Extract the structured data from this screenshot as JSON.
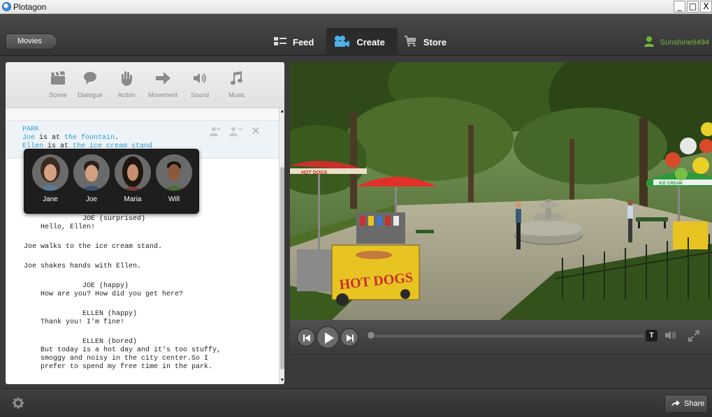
{
  "window": {
    "title": "Plotagon",
    "minimize": "_",
    "maximize": "□",
    "close": "X"
  },
  "nav": {
    "movies_label": "Movies",
    "tabs": [
      {
        "label": "Feed",
        "icon": "feed-icon"
      },
      {
        "label": "Create",
        "icon": "camera-icon"
      },
      {
        "label": "Store",
        "icon": "cart-icon"
      }
    ],
    "active_tab": "Create",
    "username": "Sunshine9494"
  },
  "toolbar": {
    "tools": [
      {
        "label": "Scene",
        "icon": "clapperboard-icon"
      },
      {
        "label": "Dialogue",
        "icon": "speech-bubble-icon"
      },
      {
        "label": "Action",
        "icon": "hand-icon"
      },
      {
        "label": "Movement",
        "icon": "arrow-right-icon"
      },
      {
        "label": "Sound",
        "icon": "speaker-icon"
      },
      {
        "label": "Music",
        "icon": "music-note-icon"
      }
    ]
  },
  "script": {
    "scene": {
      "location": "PARK",
      "line1_actor": "Joe",
      "line1_mid": " is at ",
      "line1_place": "the fountain",
      "line1_end": ".",
      "line2_actor": "Ellen",
      "line2_mid": " is at ",
      "line2_place": "the ice cream stand"
    },
    "lines": [
      "              JOE (surprised)",
      "    Hello, Ellen!",
      "Joe walks to the ice cream stand.",
      "Joe shakes hands with Ellen.",
      "              JOE (happy)",
      "    How are you? How did you get here?",
      "              ELLEN (happy)",
      "    Thank you! I'm fine!",
      "              ELLEN (bored)",
      "    But today is a hot day and it's too stuffy,",
      "    smoggy and noisy in the city center.So I",
      "    prefer to spend my free time in the park."
    ]
  },
  "characters": [
    {
      "name": "Jane"
    },
    {
      "name": "Joe"
    },
    {
      "name": "Maria"
    },
    {
      "name": "Will"
    }
  ],
  "scene_signs": {
    "hotdog_umbrella": "HOT DOGS",
    "hotdog_cart": "HOT DOGS",
    "icecream_umbrella": "ICE CREAM"
  },
  "player": {
    "progress": 0.0
  },
  "bottom": {
    "share_label": "Share"
  }
}
